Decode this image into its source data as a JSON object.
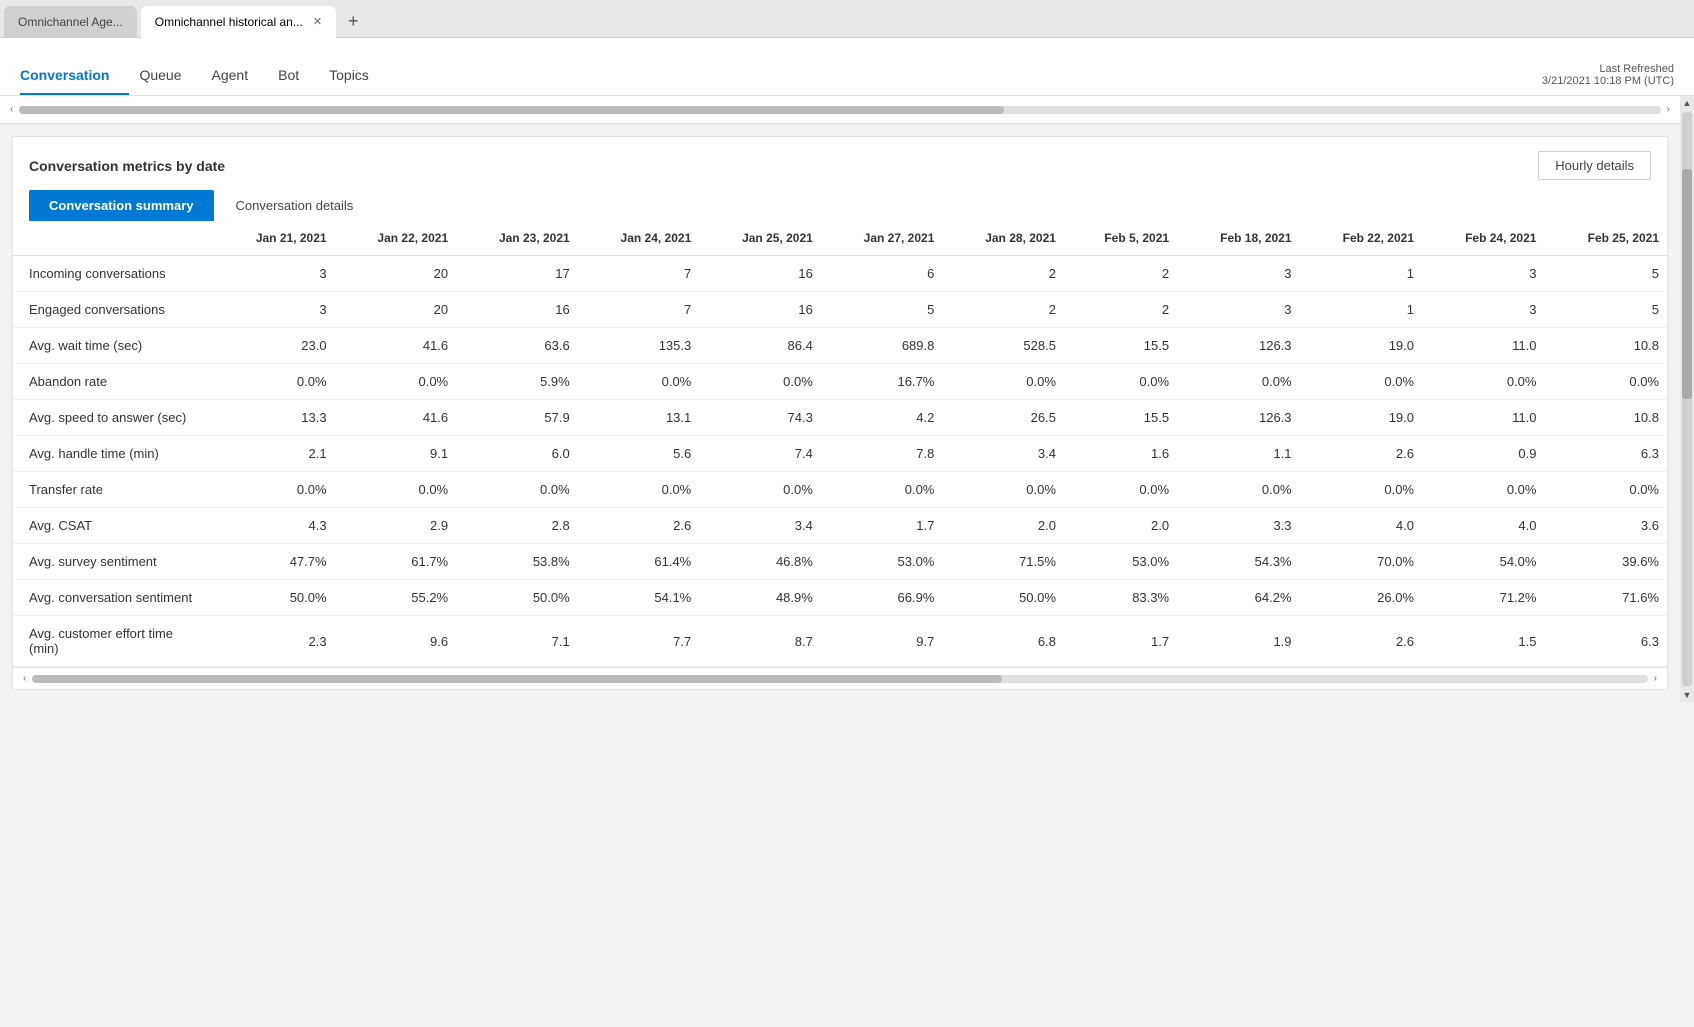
{
  "browser": {
    "tabs": [
      {
        "id": "tab1",
        "label": "Omnichannel Age...",
        "active": false
      },
      {
        "id": "tab2",
        "label": "Omnichannel historical an...",
        "active": true
      }
    ],
    "new_tab_label": "+"
  },
  "header": {
    "nav_tabs": [
      {
        "id": "conversation",
        "label": "Conversation",
        "active": true
      },
      {
        "id": "queue",
        "label": "Queue",
        "active": false
      },
      {
        "id": "agent",
        "label": "Agent",
        "active": false
      },
      {
        "id": "bot",
        "label": "Bot",
        "active": false
      },
      {
        "id": "topics",
        "label": "Topics",
        "active": false
      }
    ],
    "last_refreshed_label": "Last Refreshed",
    "last_refreshed_date": "3/21/2021 10:18 PM (UTC)"
  },
  "card": {
    "title": "Conversation metrics by date",
    "hourly_details_label": "Hourly details",
    "sub_tabs": [
      {
        "id": "summary",
        "label": "Conversation summary",
        "active": true
      },
      {
        "id": "details",
        "label": "Conversation details",
        "active": false
      }
    ],
    "table": {
      "columns": [
        "Jan 21, 2021",
        "Jan 22, 2021",
        "Jan 23, 2021",
        "Jan 24, 2021",
        "Jan 25, 2021",
        "Jan 27, 2021",
        "Jan 28, 2021",
        "Feb 5, 2021",
        "Feb 18, 2021",
        "Feb 22, 2021",
        "Feb 24, 2021",
        "Feb 25, 2021"
      ],
      "rows": [
        {
          "metric": "Incoming conversations",
          "values": [
            "3",
            "20",
            "17",
            "7",
            "16",
            "6",
            "2",
            "2",
            "3",
            "1",
            "3",
            "5"
          ]
        },
        {
          "metric": "Engaged conversations",
          "values": [
            "3",
            "20",
            "16",
            "7",
            "16",
            "5",
            "2",
            "2",
            "3",
            "1",
            "3",
            "5"
          ]
        },
        {
          "metric": "Avg. wait time (sec)",
          "values": [
            "23.0",
            "41.6",
            "63.6",
            "135.3",
            "86.4",
            "689.8",
            "528.5",
            "15.5",
            "126.3",
            "19.0",
            "11.0",
            "10.8"
          ]
        },
        {
          "metric": "Abandon rate",
          "values": [
            "0.0%",
            "0.0%",
            "5.9%",
            "0.0%",
            "0.0%",
            "16.7%",
            "0.0%",
            "0.0%",
            "0.0%",
            "0.0%",
            "0.0%",
            "0.0%"
          ]
        },
        {
          "metric": "Avg. speed to answer (sec)",
          "values": [
            "13.3",
            "41.6",
            "57.9",
            "13.1",
            "74.3",
            "4.2",
            "26.5",
            "15.5",
            "126.3",
            "19.0",
            "11.0",
            "10.8"
          ]
        },
        {
          "metric": "Avg. handle time (min)",
          "values": [
            "2.1",
            "9.1",
            "6.0",
            "5.6",
            "7.4",
            "7.8",
            "3.4",
            "1.6",
            "1.1",
            "2.6",
            "0.9",
            "6.3"
          ]
        },
        {
          "metric": "Transfer rate",
          "values": [
            "0.0%",
            "0.0%",
            "0.0%",
            "0.0%",
            "0.0%",
            "0.0%",
            "0.0%",
            "0.0%",
            "0.0%",
            "0.0%",
            "0.0%",
            "0.0%"
          ]
        },
        {
          "metric": "Avg. CSAT",
          "values": [
            "4.3",
            "2.9",
            "2.8",
            "2.6",
            "3.4",
            "1.7",
            "2.0",
            "2.0",
            "3.3",
            "4.0",
            "4.0",
            "3.6"
          ]
        },
        {
          "metric": "Avg. survey sentiment",
          "values": [
            "47.7%",
            "61.7%",
            "53.8%",
            "61.4%",
            "46.8%",
            "53.0%",
            "71.5%",
            "53.0%",
            "54.3%",
            "70.0%",
            "54.0%",
            "39.6%"
          ]
        },
        {
          "metric": "Avg. conversation sentiment",
          "values": [
            "50.0%",
            "55.2%",
            "50.0%",
            "54.1%",
            "48.9%",
            "66.9%",
            "50.0%",
            "83.3%",
            "64.2%",
            "26.0%",
            "71.2%",
            "71.6%"
          ]
        },
        {
          "metric": "Avg. customer effort time (min)",
          "values": [
            "2.3",
            "9.6",
            "7.1",
            "7.7",
            "8.7",
            "9.7",
            "6.8",
            "1.7",
            "1.9",
            "2.6",
            "1.5",
            "6.3"
          ]
        }
      ]
    }
  }
}
